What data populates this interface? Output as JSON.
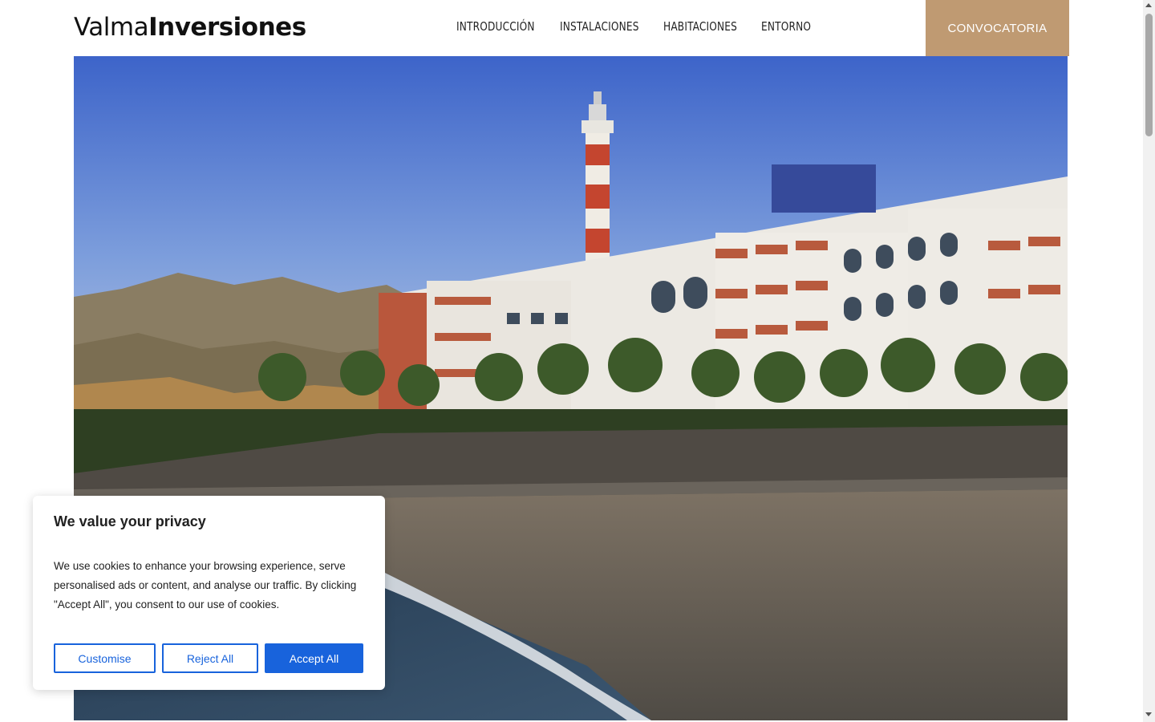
{
  "header": {
    "logo_light": "Valma",
    "logo_bold": "Inversiones",
    "nav": [
      "INTRODUCCIÓN",
      "INSTALACIONES",
      "HABITACIONES",
      "ENTORNO"
    ],
    "cta_label": "CONVOCATORIA"
  },
  "cookie_banner": {
    "title": "We value your privacy",
    "text": "We use cookies to enhance your browsing experience, serve personalised ads or content, and analyse our traffic. By clicking \"Accept All\", you consent to our use of cookies.",
    "customise_label": "Customise",
    "reject_label": "Reject All",
    "accept_label": "Accept All"
  },
  "colors": {
    "accent_cta": "#bf9a72",
    "button_blue": "#1863dc"
  },
  "icons": {
    "scroll_up": "scroll-up-arrow-icon",
    "scroll_down": "scroll-down-arrow-icon"
  }
}
